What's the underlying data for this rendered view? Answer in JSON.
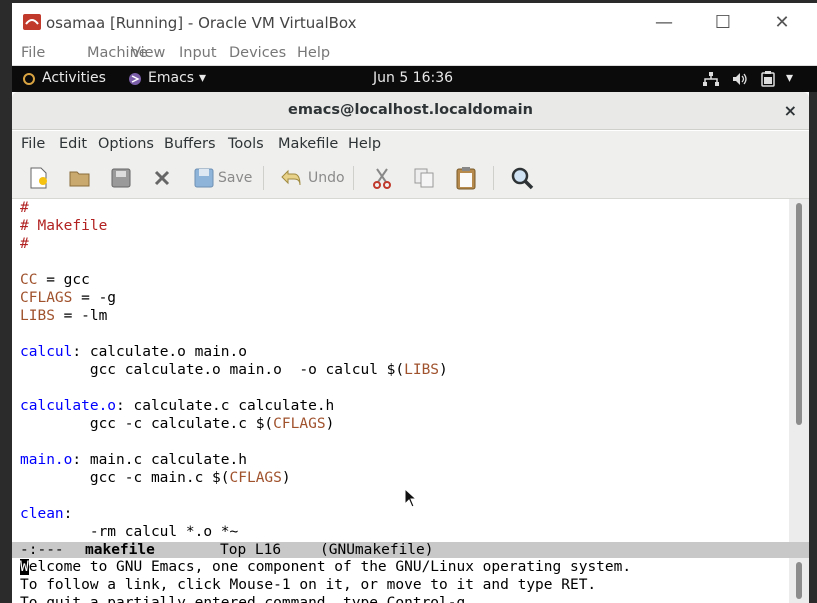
{
  "vbox": {
    "title": "osamaa [Running] - Oracle VM VirtualBox",
    "menu": [
      "File",
      "Machine",
      "View",
      "Input",
      "Devices",
      "Help"
    ],
    "controls": {
      "minimize": "—",
      "maximize": "☐",
      "close": "✕"
    }
  },
  "gnome": {
    "activities": "Activities",
    "app": "Emacs",
    "clock": "Jun 5  16:36"
  },
  "emacs": {
    "title": "emacs@localhost.localdomain",
    "close": "×",
    "menu": [
      "File",
      "Edit",
      "Options",
      "Buffers",
      "Tools",
      "Makefile",
      "Help"
    ],
    "toolbar": {
      "save_label": "Save",
      "undo_label": "Undo"
    },
    "buffer_lines": [
      {
        "parts": [
          {
            "t": "#",
            "c": "comment"
          }
        ]
      },
      {
        "parts": [
          {
            "t": "# Makefile",
            "c": "comment"
          }
        ]
      },
      {
        "parts": [
          {
            "t": "#",
            "c": "comment"
          }
        ]
      },
      {
        "parts": [
          {
            "t": "",
            "c": ""
          }
        ]
      },
      {
        "parts": [
          {
            "t": "CC",
            "c": "var"
          },
          {
            "t": " = gcc",
            "c": ""
          }
        ]
      },
      {
        "parts": [
          {
            "t": "CFLAGS",
            "c": "var"
          },
          {
            "t": " = -g",
            "c": ""
          }
        ]
      },
      {
        "parts": [
          {
            "t": "LIBS",
            "c": "var"
          },
          {
            "t": " = -lm",
            "c": ""
          }
        ]
      },
      {
        "parts": [
          {
            "t": "",
            "c": ""
          }
        ]
      },
      {
        "parts": [
          {
            "t": "calcul",
            "c": "target"
          },
          {
            "t": ": calculate.o main.o",
            "c": ""
          }
        ]
      },
      {
        "parts": [
          {
            "t": "        gcc calculate.o main.o  -o calcul $(",
            "c": ""
          },
          {
            "t": "LIBS",
            "c": "var"
          },
          {
            "t": ")",
            "c": ""
          }
        ]
      },
      {
        "parts": [
          {
            "t": "",
            "c": ""
          }
        ]
      },
      {
        "parts": [
          {
            "t": "calculate.o",
            "c": "target"
          },
          {
            "t": ": calculate.c calculate.h",
            "c": ""
          }
        ]
      },
      {
        "parts": [
          {
            "t": "        gcc -c calculate.c $(",
            "c": ""
          },
          {
            "t": "CFLAGS",
            "c": "var"
          },
          {
            "t": ")",
            "c": ""
          }
        ]
      },
      {
        "parts": [
          {
            "t": "",
            "c": ""
          }
        ]
      },
      {
        "parts": [
          {
            "t": "main.o",
            "c": "target"
          },
          {
            "t": ": main.c calculate.h",
            "c": ""
          }
        ]
      },
      {
        "parts": [
          {
            "t": "        gcc -c main.c $(",
            "c": ""
          },
          {
            "t": "CFLAGS",
            "c": "var"
          },
          {
            "t": ")",
            "c": ""
          }
        ]
      },
      {
        "parts": [
          {
            "t": "",
            "c": ""
          }
        ]
      },
      {
        "parts": [
          {
            "t": "clean",
            "c": "target"
          },
          {
            "t": ":",
            "c": ""
          }
        ]
      },
      {
        "parts": [
          {
            "t": "        -rm calcul *.o *~",
            "c": ""
          }
        ]
      }
    ],
    "modeline": {
      "status": "-:---",
      "buffer_name": "makefile",
      "position": "Top L16",
      "mode": "(GNUmakefile)"
    },
    "echo_lines": [
      "Welcome to GNU Emacs, one component of the GNU/Linux operating system.",
      "To follow a link, click Mouse-1 on it, or move to it and type RET.",
      "To quit a partially entered command, type Control-g."
    ]
  },
  "colors": {
    "comment": "#b22222",
    "variable": "#a0522d",
    "target": "#0000ff"
  }
}
